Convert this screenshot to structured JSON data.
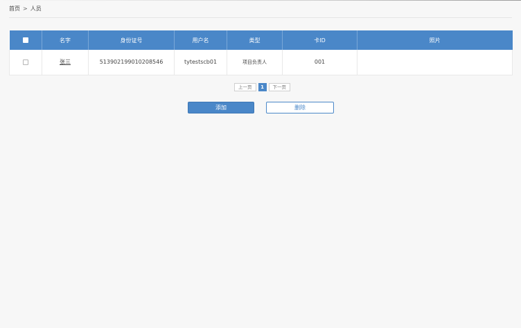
{
  "breadcrumb": {
    "home": "首页",
    "separator": ">",
    "current": "人员"
  },
  "table": {
    "headers": {
      "name": "名字",
      "id_number": "身份证号",
      "username": "用户名",
      "type": "类型",
      "card_id": "卡ID",
      "photo": "照片"
    },
    "rows": [
      {
        "name": "张三",
        "id_number": "513902199010208546",
        "username": "tytestscb01",
        "type": "项目负责人",
        "card_id": "001",
        "photo": "",
        "checked": false
      }
    ]
  },
  "pagination": {
    "prev_label": "上一页",
    "current_page": "1",
    "next_label": "下一页"
  },
  "actions": {
    "add_label": "添加",
    "delete_label": "删除"
  },
  "colors": {
    "accent": "#4a87c8",
    "background": "#f7f7f7"
  }
}
